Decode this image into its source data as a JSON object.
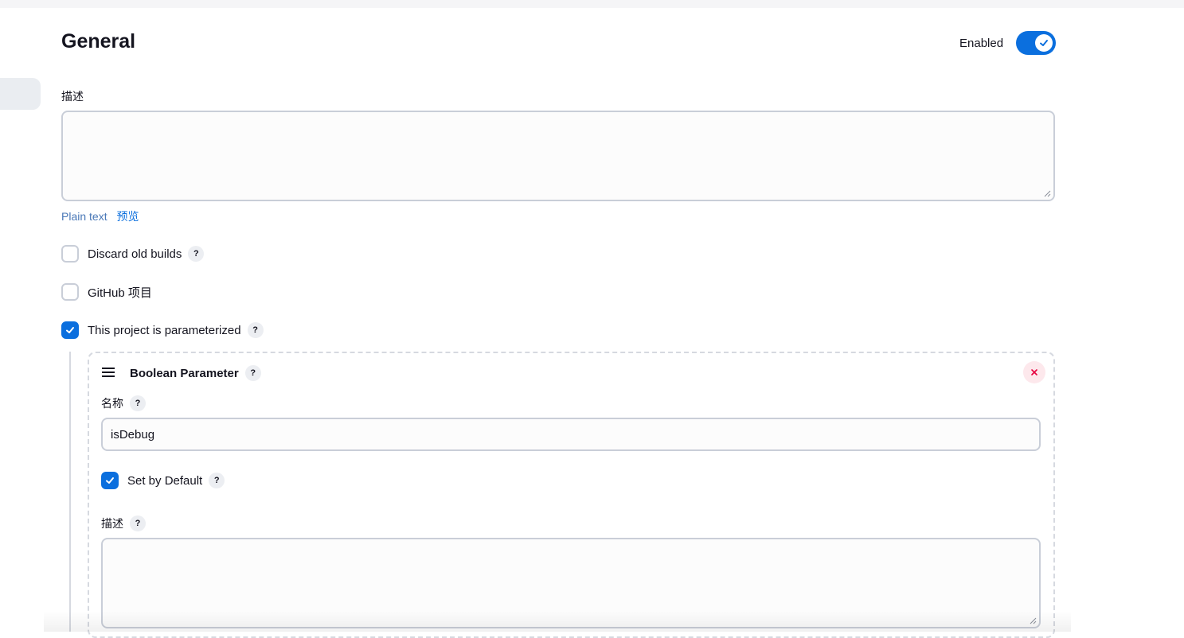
{
  "section": {
    "title": "General"
  },
  "enabled": {
    "label": "Enabled",
    "on": true
  },
  "description": {
    "label": "描述",
    "value": ""
  },
  "format": {
    "plain_label": "Plain text",
    "preview_label": "预览"
  },
  "options": [
    {
      "label": "Discard old builds",
      "checked": false,
      "help": "?"
    },
    {
      "label": "GitHub 项目",
      "checked": false
    },
    {
      "label": "This project is parameterized",
      "checked": true,
      "help": "?"
    }
  ],
  "parameter": {
    "type_label": "Boolean Parameter",
    "help": "?",
    "name_label": "名称",
    "name_value": "isDebug",
    "default_label": "Set by Default",
    "default_checked": true,
    "description_label": "描述",
    "description_value": ""
  },
  "colors": {
    "accent": "#0b6fde",
    "danger": "#e6003e",
    "border": "#c9ced8"
  },
  "icons": {
    "toggle": "check-icon",
    "close": "close-icon",
    "drag": "drag-handle-icon",
    "help": "help-icon"
  }
}
